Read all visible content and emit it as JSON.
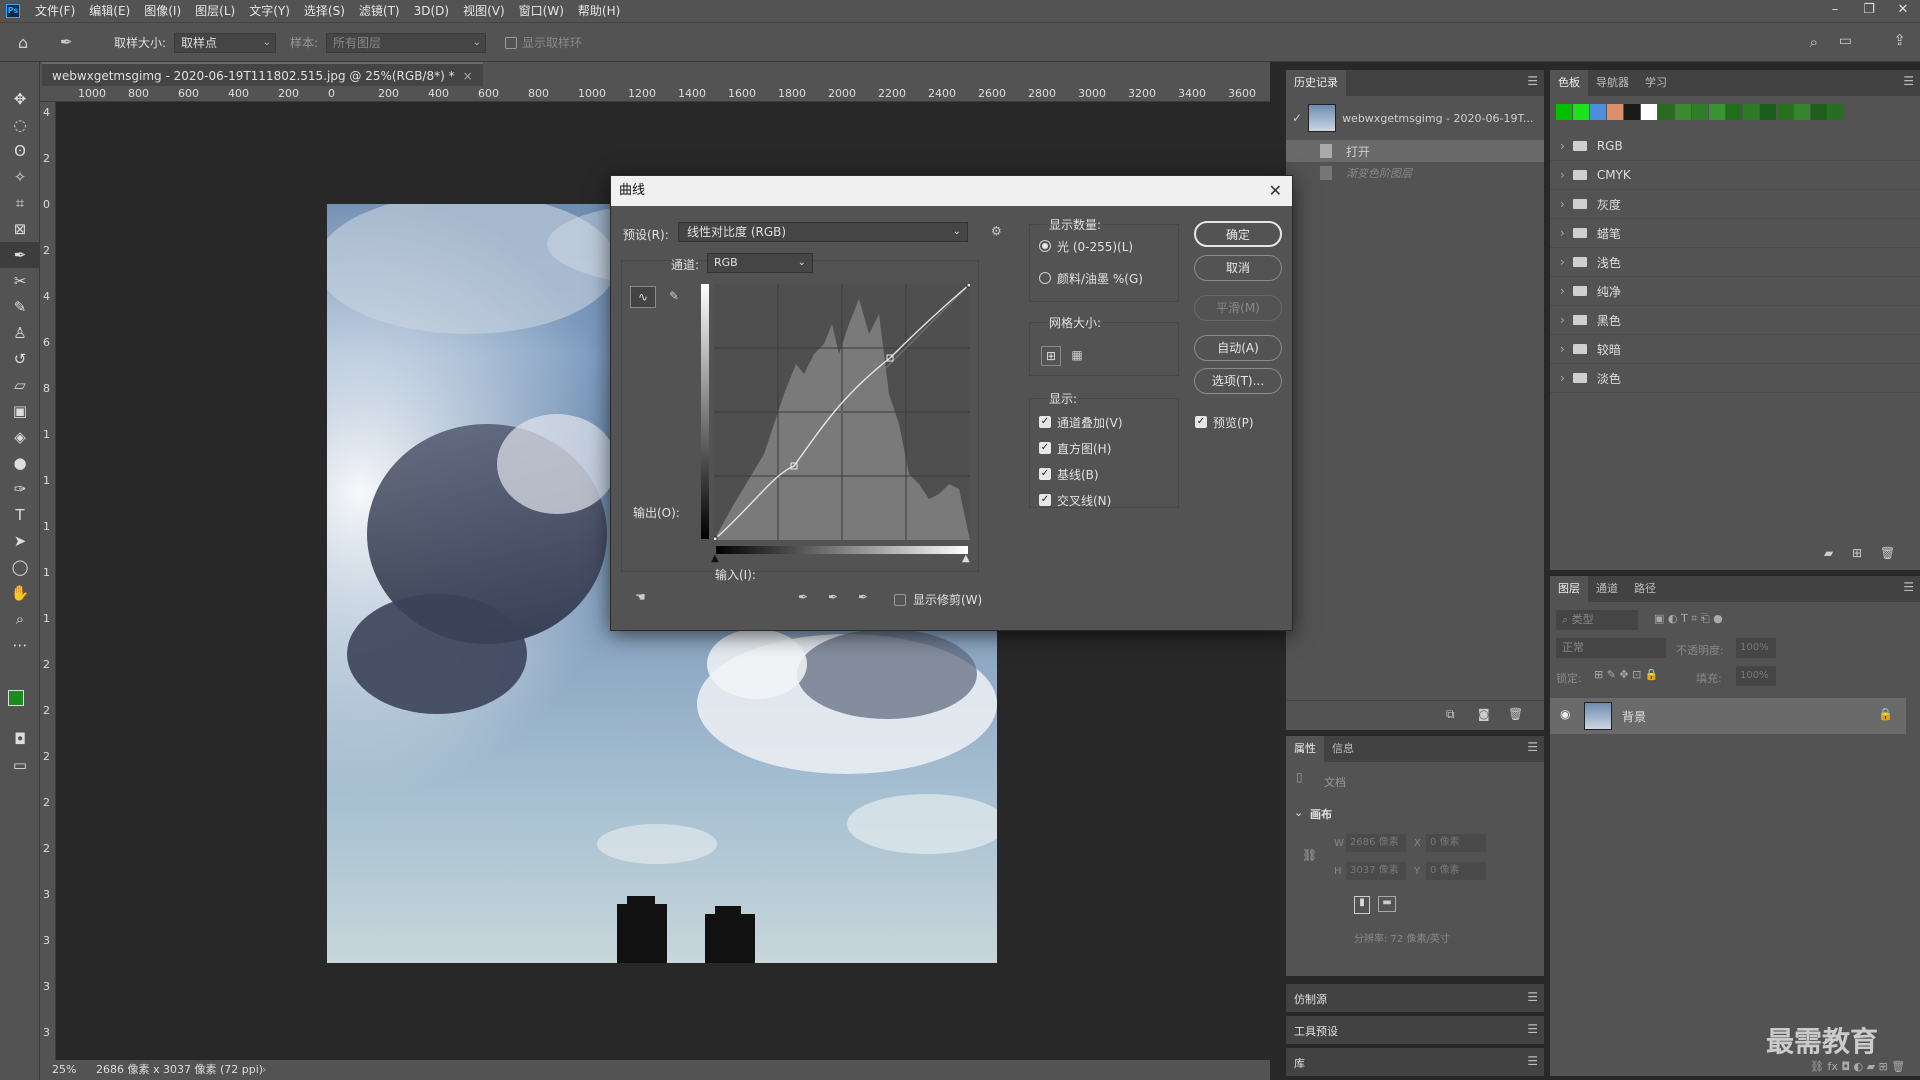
{
  "menubar": {
    "logo": "Ps",
    "items": [
      "文件(F)",
      "编辑(E)",
      "图像(I)",
      "图层(L)",
      "文字(Y)",
      "选择(S)",
      "滤镜(T)",
      "3D(D)",
      "视图(V)",
      "窗口(W)",
      "帮助(H)"
    ]
  },
  "options": {
    "sample_size_label": "取样大小:",
    "sample_size_value": "取样点",
    "sample_label": "样本:",
    "sample_value": "所有图层",
    "show_ring": "显示取样环"
  },
  "document": {
    "tab_title": "webwxgetmsgimg - 2020-06-19T111802.515.jpg @ 25%(RGB/8*) *",
    "ruler_h": [
      "1000",
      "800",
      "600",
      "400",
      "200",
      "0",
      "200",
      "400",
      "600",
      "800",
      "1000",
      "1200",
      "1400",
      "1600",
      "1800",
      "2000",
      "2200",
      "2400",
      "2600",
      "2800",
      "3000",
      "3200",
      "3400",
      "3600"
    ],
    "ruler_v": [
      "4",
      "2",
      "0",
      "2",
      "4",
      "6",
      "8",
      "1",
      "1",
      "1",
      "1",
      "1",
      "2",
      "2",
      "2",
      "2",
      "2",
      "3",
      "3",
      "3",
      "3"
    ],
    "zoom": "25%",
    "doc_info": "2686 像素 x 3037 像素 (72 ppi)"
  },
  "history": {
    "tabs": [
      "历史记录"
    ],
    "snapshot": "webwxgetmsgimg - 2020-06-19T...",
    "items": [
      "打开",
      "渐变色阶图层"
    ]
  },
  "swatches": {
    "tabs": [
      "色板",
      "导航器",
      "学习"
    ],
    "colors": [
      "#00c000",
      "#1fe21f",
      "#4c8fd8",
      "#d8916b",
      "#1a1a1a",
      "#ffffff",
      "#2a6a22",
      "#3a8a2e",
      "#2f7d2a",
      "#3b9232",
      "#226c1e",
      "#2c7a26",
      "#1e5e1c",
      "#2a6e22",
      "#35852d",
      "#215e1d",
      "#2b6c24"
    ],
    "groups": [
      "RGB",
      "CMYK",
      "灰度",
      "蜡笔",
      "浅色",
      "纯净",
      "黑色",
      "较暗",
      "淡色"
    ]
  },
  "layers": {
    "tabs": [
      "图层",
      "通道",
      "路径"
    ],
    "filter_placeholder": "类型",
    "blend": "正常",
    "opacity_label": "不透明度:",
    "opacity": "100%",
    "lock_label": "锁定:",
    "fill_label": "填充:",
    "fill": "100%",
    "layer_name": "背景"
  },
  "properties": {
    "tabs": [
      "属性",
      "信息"
    ],
    "doc_label": "文档",
    "canvas_label": "画布",
    "w_label": "W",
    "w": "2686 像素",
    "h_label": "H",
    "h": "3037 像素",
    "x_label": "X",
    "x": "0 像素",
    "y_label": "Y",
    "y": "0 像素",
    "resolution": "分辨率: 72 像素/英寸"
  },
  "collapsed_panels": [
    "仿制源",
    "工具预设",
    "库"
  ],
  "watermark": "最需教育",
  "curves": {
    "title": "曲线",
    "preset_label": "预设(R):",
    "preset_value": "线性对比度 (RGB)",
    "channel_label": "通道:",
    "channel_value": "RGB",
    "output_label": "输出(O):",
    "input_label": "输入(I):",
    "show_clipping": "显示修剪(W)",
    "display_amount": "显示数量:",
    "light": "光 (0-255)(L)",
    "pigment": "颜料/油墨 %(G)",
    "grid_size": "网格大小:",
    "show": "显示:",
    "channel_overlay": "通道叠加(V)",
    "histogram": "直方图(H)",
    "baseline": "基线(B)",
    "intersection": "交叉线(N)",
    "ok": "确定",
    "cancel": "取消",
    "smooth": "平滑(M)",
    "auto": "自动(A)",
    "options": "选项(T)...",
    "preview": "预览(P)"
  }
}
